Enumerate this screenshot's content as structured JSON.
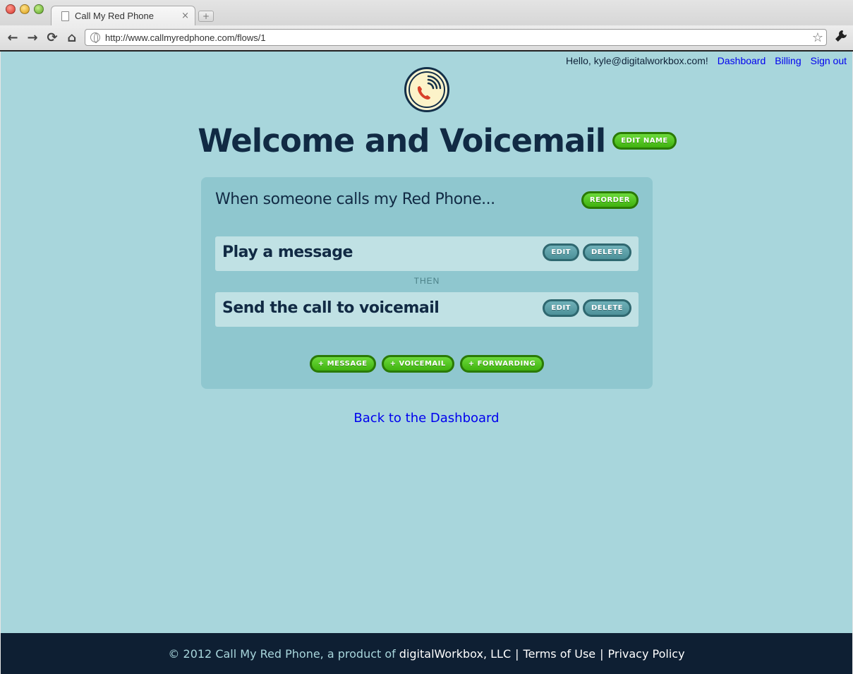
{
  "browser": {
    "tab_title": "Call My Red Phone",
    "tab_close": "×",
    "new_tab": "+",
    "url": "http://www.callmyredphone.com/flows/1",
    "back": "←",
    "forward": "→",
    "reload": "⟳",
    "home": "⌂",
    "star": "☆",
    "wrench": "🔧"
  },
  "topbar": {
    "greeting": "Hello, kyle@digitalworkbox.com!",
    "links": [
      "Dashboard",
      "Billing",
      "Sign out"
    ]
  },
  "header": {
    "title": "Welcome and Voicemail",
    "edit_name": "EDIT NAME"
  },
  "flow": {
    "heading": "When someone calls my Red Phone...",
    "reorder": "REORDER",
    "steps": [
      {
        "label": "Play a message",
        "edit": "EDIT",
        "delete": "DELETE"
      },
      {
        "label": "Send the call to voicemail",
        "edit": "EDIT",
        "delete": "DELETE"
      }
    ],
    "connector": "THEN",
    "add_buttons": [
      "+ MESSAGE",
      "+ VOICEMAIL",
      "+ FORWARDING"
    ]
  },
  "back_link": "Back to the Dashboard",
  "footer": {
    "copyright": "© 2012 Call My Red Phone, a product of",
    "company": "digitalWorkbox, LLC",
    "sep1": "|",
    "terms": "Terms of Use",
    "sep2": "|",
    "privacy": "Privacy Policy"
  },
  "colors": {
    "page_bg": "#a8d6dc",
    "panel_bg": "#8fc7cf",
    "step_bg": "#c0e1e4",
    "green_button": "#4ec41d",
    "teal_button": "#5a9ea6",
    "navy_text": "#112a44",
    "footer_bg": "#0e1f33",
    "link": "#0000ee"
  },
  "icons": {
    "logo": "red-phone-with-signal-waves-logo"
  }
}
